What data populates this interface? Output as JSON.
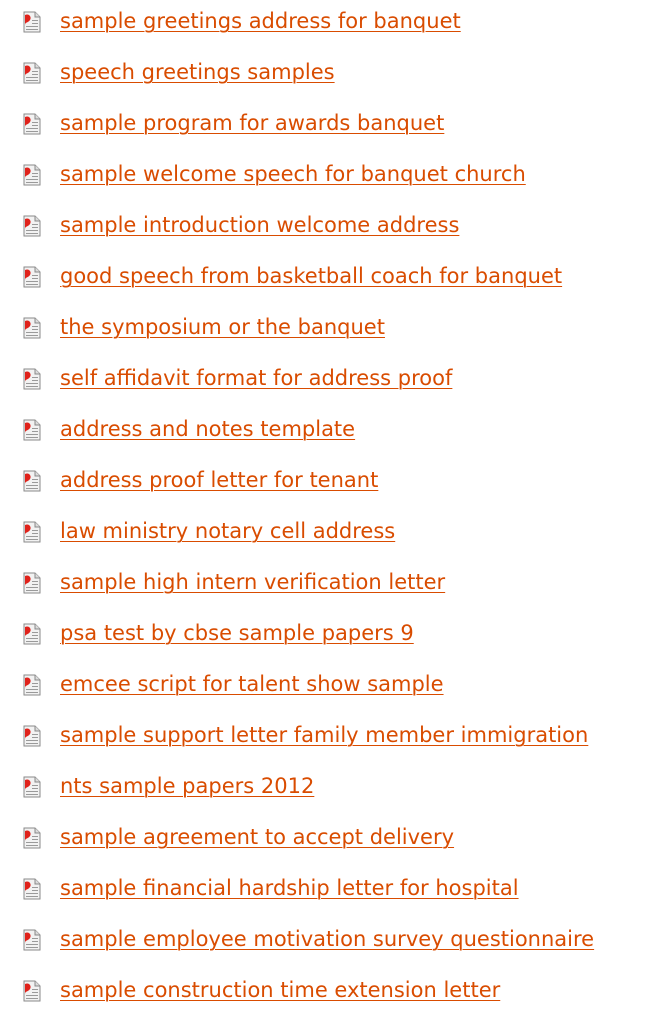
{
  "colors": {
    "link": "#d94c00",
    "icon_red": "#e0221b",
    "icon_page": "#f2f2f2",
    "icon_border": "#8a8a8a"
  },
  "links": {
    "icon": "pdf-file-icon",
    "items": [
      {
        "label": "sample greetings address for banquet"
      },
      {
        "label": "speech greetings samples"
      },
      {
        "label": "sample program for awards banquet"
      },
      {
        "label": "sample welcome speech for banquet church"
      },
      {
        "label": "sample introduction welcome address"
      },
      {
        "label": "good speech from basketball coach for banquet"
      },
      {
        "label": "the symposium or the banquet"
      },
      {
        "label": "self affidavit format for address proof"
      },
      {
        "label": "address and notes template"
      },
      {
        "label": "address proof letter for tenant"
      },
      {
        "label": "law ministry notary cell address"
      },
      {
        "label": "sample high intern verification letter"
      },
      {
        "label": "psa test by cbse sample papers 9"
      },
      {
        "label": "emcee script for talent show sample"
      },
      {
        "label": "sample support letter family member immigration"
      },
      {
        "label": "nts sample papers 2012"
      },
      {
        "label": "sample agreement to accept delivery"
      },
      {
        "label": "sample financial hardship letter for hospital"
      },
      {
        "label": "sample employee motivation survey questionnaire"
      },
      {
        "label": "sample construction time extension letter"
      }
    ]
  }
}
